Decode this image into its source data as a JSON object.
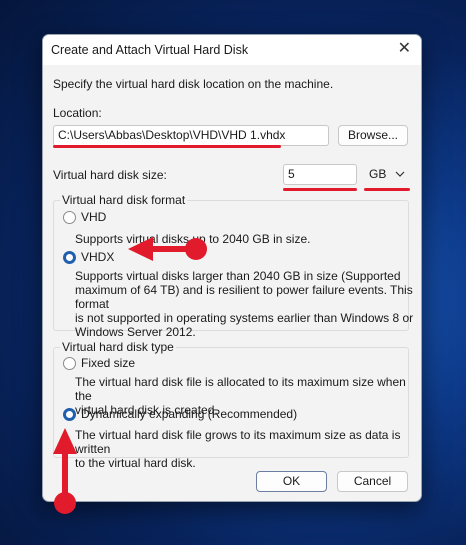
{
  "dialog": {
    "title": "Create and Attach Virtual Hard Disk",
    "instruction": "Specify the virtual hard disk location on the machine.",
    "location_label": "Location:",
    "location_value": "C:\\Users\\Abbas\\Desktop\\VHD\\VHD 1.vhdx",
    "browse_label": "Browse...",
    "size_label": "Virtual hard disk size:",
    "size_value": "5",
    "unit_value": "GB",
    "format_group": {
      "legend": "Virtual hard disk format",
      "options": [
        {
          "label": "VHD",
          "selected": false,
          "description": "Supports virtual disks up to 2040 GB in size."
        },
        {
          "label": "VHDX",
          "selected": true,
          "description_lines": [
            "Supports virtual disks larger than 2040 GB in size (Supported",
            "maximum of 64 TB) and is resilient to power failure events. This format",
            "is not supported in operating systems earlier than Windows 8 or",
            "Windows Server 2012."
          ]
        }
      ]
    },
    "type_group": {
      "legend": "Virtual hard disk type",
      "options": [
        {
          "label": "Fixed size",
          "selected": false,
          "description_lines": [
            "The virtual hard disk file is allocated to its maximum size when the",
            "virtual hard disk is created."
          ]
        },
        {
          "label": "Dynamically expanding (Recommended)",
          "selected": true,
          "description_lines": [
            "The virtual hard disk file grows to its maximum size as data is written",
            "to the virtual hard disk."
          ]
        }
      ]
    },
    "ok_label": "OK",
    "cancel_label": "Cancel"
  },
  "colors": {
    "annotation_red": "#e11b2b",
    "radio_selected": "#1f5fad",
    "dialog_bg": "#f3f3f3"
  }
}
